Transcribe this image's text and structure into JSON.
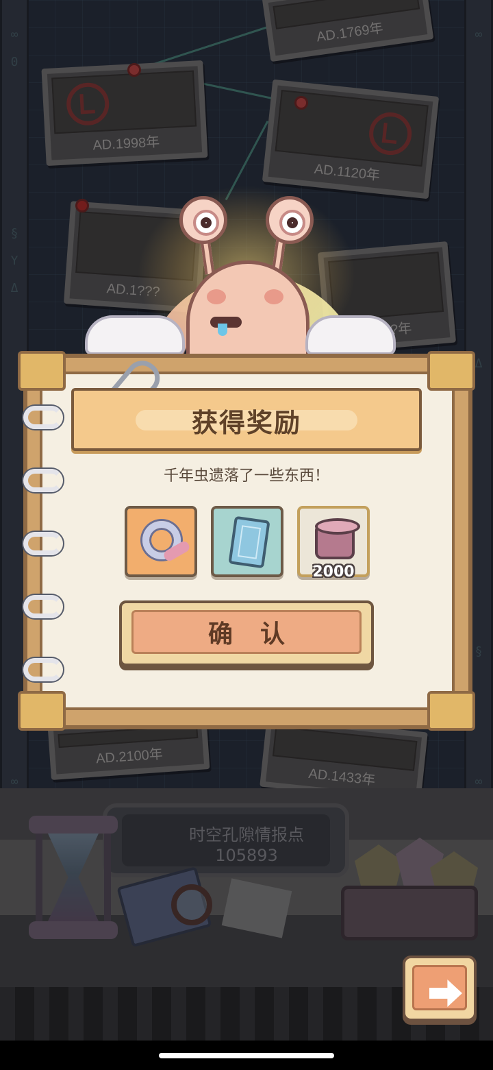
{
  "background": {
    "photos": [
      {
        "caption": "AD.1769年"
      },
      {
        "caption": "AD.1998年"
      },
      {
        "caption": "AD.1120年"
      },
      {
        "caption": "AD.1???"
      },
      {
        "caption": "AD.?年"
      },
      {
        "caption": "AD.2100年"
      },
      {
        "caption": "AD.1433年"
      }
    ],
    "console": {
      "title": "时空孔隙情报点",
      "value": "105893"
    }
  },
  "dialog": {
    "title": "获得奖励",
    "subtitle": "千年虫遗落了一些东西！",
    "rewards": [
      {
        "icon": "wreath-icon",
        "quantity": ""
      },
      {
        "icon": "card-icon",
        "quantity": ""
      },
      {
        "icon": "scroll-icon",
        "quantity": "2000"
      }
    ],
    "confirm_label": "确认"
  },
  "next_button": {
    "icon": "right-arrow-icon"
  },
  "colors": {
    "dialog_title_bg": "#f4c98c",
    "confirm_button": "#eeab84",
    "notebook_frame": "#cfa36c"
  }
}
